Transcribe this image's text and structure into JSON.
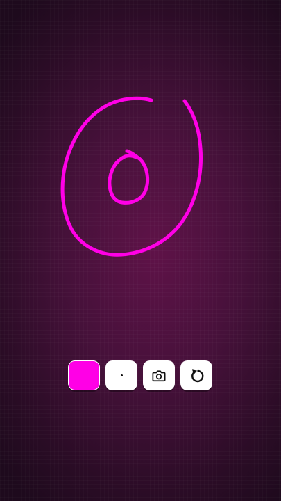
{
  "app": {
    "background_color": "#4a1040"
  },
  "drawing": {
    "stroke_color": "#ff00e6",
    "strokes": [
      {
        "name": "outer-loop"
      },
      {
        "name": "inner-loop"
      }
    ]
  },
  "toolbar": {
    "color_swatch": {
      "color": "#ff00e6",
      "icon": "color-swatch"
    },
    "brush_size": {
      "icon": "dot-icon"
    },
    "snapshot": {
      "icon": "camera-icon"
    },
    "reset": {
      "icon": "undo-icon"
    }
  }
}
